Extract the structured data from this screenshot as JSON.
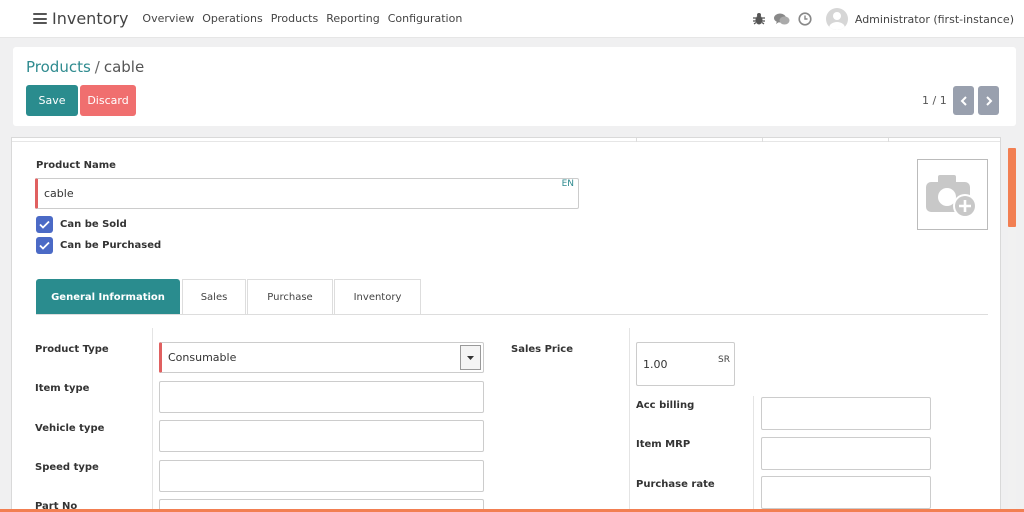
{
  "navbar": {
    "app_name": "Inventory",
    "menu": [
      "Overview",
      "Operations",
      "Products",
      "Reporting",
      "Configuration"
    ],
    "user": "Administrator (first-instance)",
    "icons": [
      "bug-icon",
      "chat-icon",
      "clock-icon"
    ]
  },
  "breadcrumb": {
    "parent": "Products",
    "separator": "/",
    "current": "cable"
  },
  "buttons": {
    "save": "Save",
    "discard": "Discard"
  },
  "pager": {
    "value": "1 / 1"
  },
  "form": {
    "product_name_label": "Product Name",
    "product_name_value": "cable",
    "lang": "EN",
    "can_be_sold_label": "Can be Sold",
    "can_be_sold": true,
    "can_be_purchased_label": "Can be Purchased",
    "can_be_purchased": true,
    "tabs": [
      {
        "label": "General Information",
        "active": true
      },
      {
        "label": "Sales",
        "active": false
      },
      {
        "label": "Purchase",
        "active": false
      },
      {
        "label": "Inventory",
        "active": false
      }
    ],
    "left_fields": [
      {
        "label": "Product Type",
        "value": "Consumable"
      },
      {
        "label": "Item type",
        "value": ""
      },
      {
        "label": "Vehicle type",
        "value": ""
      },
      {
        "label": "Speed type",
        "value": ""
      },
      {
        "label": "Part No",
        "value": ""
      }
    ],
    "sales_price_label": "Sales Price",
    "sales_price_value": "1.00",
    "sales_price_currency": "SR",
    "right_fields": [
      {
        "label": "Acc billing",
        "value": ""
      },
      {
        "label": "Item MRP",
        "value": ""
      },
      {
        "label": "Purchase rate",
        "value": ""
      }
    ]
  },
  "colors": {
    "primary": "#2a8c8e",
    "danger": "#f06f6f",
    "checkbox": "#4b6ac6",
    "scroll_accent": "#f27f52"
  }
}
